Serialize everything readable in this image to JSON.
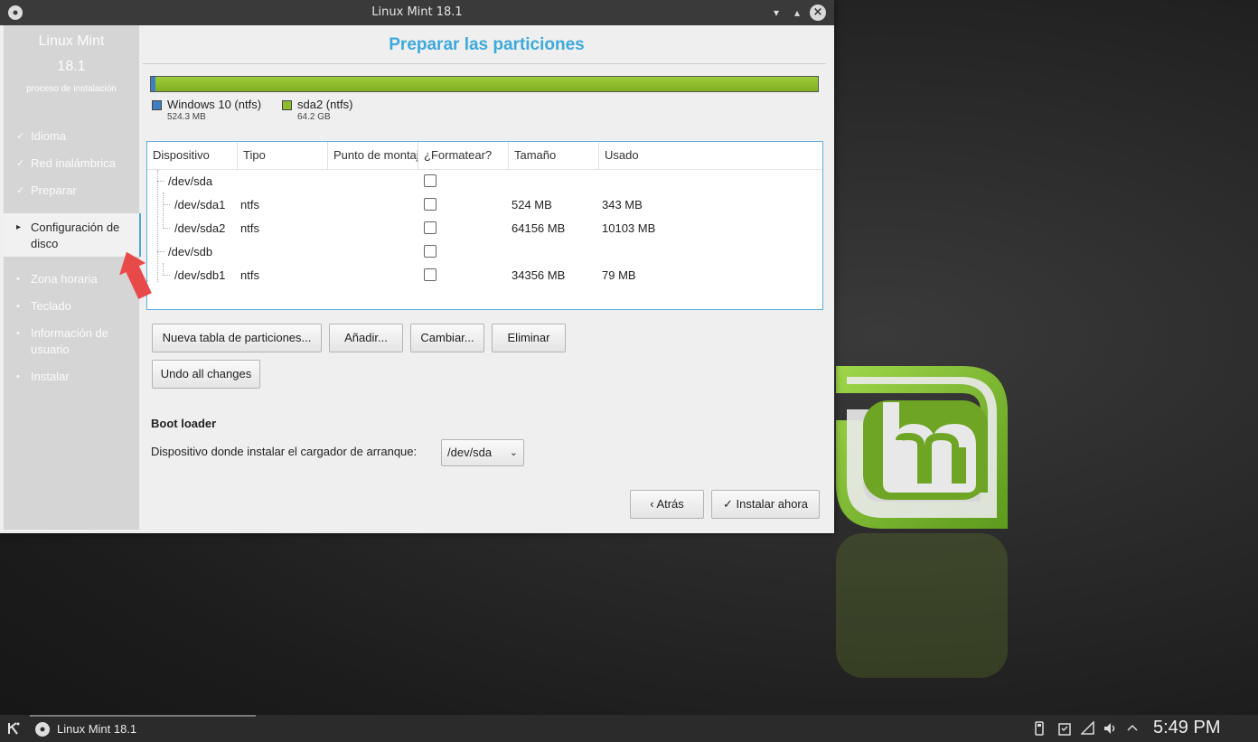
{
  "window": {
    "title": "Linux Mint 18.1"
  },
  "sidebar": {
    "product": "Linux Mint",
    "version": "18.1",
    "subtitle": "proceso de instalación",
    "steps": [
      {
        "label": "Idioma",
        "marker": "✓"
      },
      {
        "label": "Red inalámbrica",
        "marker": "✓"
      },
      {
        "label": "Preparar",
        "marker": "✓"
      },
      {
        "label": "Configuración de disco",
        "marker": "▸"
      },
      {
        "label": "Zona horaria",
        "marker": "•"
      },
      {
        "label": "Teclado",
        "marker": "•"
      },
      {
        "label": "Información de usuario",
        "marker": "•"
      },
      {
        "label": "Instalar",
        "marker": "•"
      }
    ]
  },
  "page": {
    "title": "Preparar las particiones"
  },
  "partitions_bar": {
    "segments": [
      {
        "name": "Windows 10 (ntfs)",
        "size": "524.3 MB",
        "color": "#3c7fc2"
      },
      {
        "name": "sda2 (ntfs)",
        "size": "64.2 GB",
        "color": "#8dbd2c"
      }
    ]
  },
  "table": {
    "columns": [
      "Dispositivo",
      "Tipo",
      "Punto de montaje",
      "¿Formatear?",
      "Tamaño",
      "Usado"
    ],
    "rows": [
      {
        "device": "/dev/sda",
        "type": "",
        "mount": "",
        "size": "",
        "used": "",
        "level": 0
      },
      {
        "device": "/dev/sda1",
        "type": "ntfs",
        "mount": "",
        "size": "524 MB",
        "used": "343 MB",
        "level": 1
      },
      {
        "device": "/dev/sda2",
        "type": "ntfs",
        "mount": "",
        "size": "64156 MB",
        "used": "10103 MB",
        "level": 1
      },
      {
        "device": "/dev/sdb",
        "type": "",
        "mount": "",
        "size": "",
        "used": "",
        "level": 0
      },
      {
        "device": "/dev/sdb1",
        "type": "ntfs",
        "mount": "",
        "size": "34356 MB",
        "used": "79 MB",
        "level": 1
      }
    ]
  },
  "buttons": {
    "new_table": "Nueva tabla de particiones...",
    "add": "Añadir...",
    "change": "Cambiar...",
    "delete": "Eliminar",
    "undo": "Undo all changes",
    "back": "Atrás",
    "install": "Instalar ahora"
  },
  "bootloader": {
    "title": "Boot loader",
    "label": "Dispositivo donde instalar el cargador de arranque:",
    "selected": "/dev/sda"
  },
  "taskbar": {
    "task_label": "Linux Mint 18.1",
    "clock": "5:49 PM"
  }
}
